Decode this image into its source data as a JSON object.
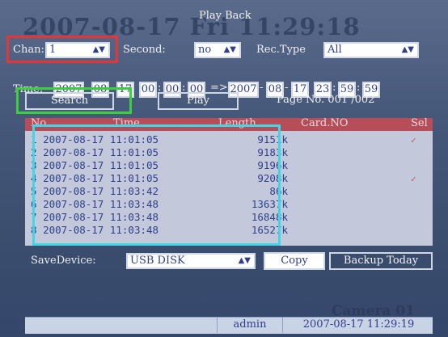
{
  "osd": {
    "date_overlay": "2007-08-17 Fri 11:29:18",
    "camera": "Camera 01"
  },
  "dialog": {
    "title": "Play Back"
  },
  "filters": {
    "chan_label": "Chan:",
    "chan_value": "1",
    "second_label": "Second:",
    "second_value": "no",
    "rec_type_label": "Rec.Type",
    "rec_type_value": "All"
  },
  "time": {
    "label": "Time:",
    "start": [
      "2007",
      "08",
      "17",
      "00",
      "00",
      "00"
    ],
    "arrow": "=>",
    "end": [
      "2007",
      "08",
      "17",
      "23",
      "59",
      "59"
    ]
  },
  "actions": {
    "search": "Search",
    "play": "Play",
    "page_no": "Page No. 001 /002"
  },
  "table": {
    "columns": [
      "No.",
      "Time",
      "Length",
      "Card.NO",
      "Sel"
    ],
    "rows": [
      {
        "no": "1",
        "time": "2007-08-17 11:01:05",
        "length": "9151k",
        "selected": true
      },
      {
        "no": "2",
        "time": "2007-08-17 11:01:05",
        "length": "9183k",
        "selected": false
      },
      {
        "no": "3",
        "time": "2007-08-17 11:01:05",
        "length": "9196k",
        "selected": false
      },
      {
        "no": "4",
        "time": "2007-08-17 11:01:05",
        "length": "9208k",
        "selected": true
      },
      {
        "no": "5",
        "time": "2007-08-17 11:03:42",
        "length": "86k",
        "selected": false
      },
      {
        "no": "6",
        "time": "2007-08-17 11:03:48",
        "length": "13637k",
        "selected": false
      },
      {
        "no": "7",
        "time": "2007-08-17 11:03:48",
        "length": "16848k",
        "selected": false
      },
      {
        "no": "8",
        "time": "2007-08-17 11:03:48",
        "length": "16527k",
        "selected": false
      }
    ],
    "check_glyph": "✓"
  },
  "save": {
    "label": "SaveDevice:",
    "device": "USB DISK",
    "copy": "Copy",
    "backup_today": "Backup Today"
  },
  "status_bar": {
    "user": "admin",
    "datetime": "2007-08-17 11:29:19"
  },
  "colors": {
    "highlight_red": "#e53535",
    "highlight_green": "#3ccf3c",
    "highlight_cyan": "#3fd6e6"
  }
}
